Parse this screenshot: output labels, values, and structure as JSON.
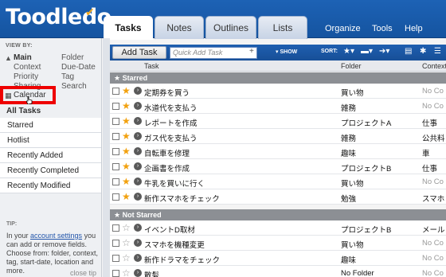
{
  "header": {
    "logo": "Toodledo",
    "tabs": [
      "Tasks",
      "Notes",
      "Outlines",
      "Lists"
    ],
    "links": [
      "Organize",
      "Tools",
      "Help"
    ]
  },
  "sidebar": {
    "view_by": "VIEW BY:",
    "col1": [
      "Main",
      "Context",
      "Priority",
      "Sharing",
      "Calendar"
    ],
    "col2": [
      "Folder",
      "Due-Date",
      "Tag",
      "Search"
    ],
    "all_tasks": "All Tasks",
    "menu": [
      "Starred",
      "Hotlist",
      "Recently Added",
      "Recently Completed",
      "Recently Modified"
    ],
    "tip_title": "TIP:",
    "tip_pre": "In your ",
    "tip_link": "account settings",
    "tip_post": " you can add or remove fields. Choose from: folder, context, tag, start-date, location and more.",
    "close_tip": "close tip"
  },
  "toolbar": {
    "add_task": "Add Task",
    "quick_placeholder": "Quick Add Task",
    "show": "SHOW",
    "sort": "SORT:"
  },
  "columns": {
    "task": "Task",
    "folder": "Folder",
    "context": "Context"
  },
  "groups": {
    "starred": "Starred",
    "not_starred": "Not Starred"
  },
  "starred_tasks": [
    {
      "name": "定期券を買う",
      "folder": "買い物",
      "context": "No Co"
    },
    {
      "name": "水道代を支払う",
      "folder": "雑務",
      "context": "No Co"
    },
    {
      "name": "レポートを作成",
      "folder": "プロジェクトA",
      "context": "仕事"
    },
    {
      "name": "ガス代を支払う",
      "folder": "雑務",
      "context": "公共料"
    },
    {
      "name": "自転車を修理",
      "folder": "趣味",
      "context": "車"
    },
    {
      "name": "企画書を作成",
      "folder": "プロジェクトB",
      "context": "仕事"
    },
    {
      "name": "牛乳を買いに行く",
      "folder": "買い物",
      "context": "No Co"
    },
    {
      "name": "新作スマホをチェック",
      "folder": "勉強",
      "context": "スマホ"
    }
  ],
  "not_starred_tasks": [
    {
      "name": "イベントD取材",
      "folder": "プロジェクトB",
      "context": "メール"
    },
    {
      "name": "スマホを機種変更",
      "folder": "買い物",
      "context": "No Co"
    },
    {
      "name": "新作ドラマをチェック",
      "folder": "趣味",
      "context": "No Co"
    },
    {
      "name": "散髪",
      "folder": "No Folder",
      "context": "No Co"
    }
  ]
}
